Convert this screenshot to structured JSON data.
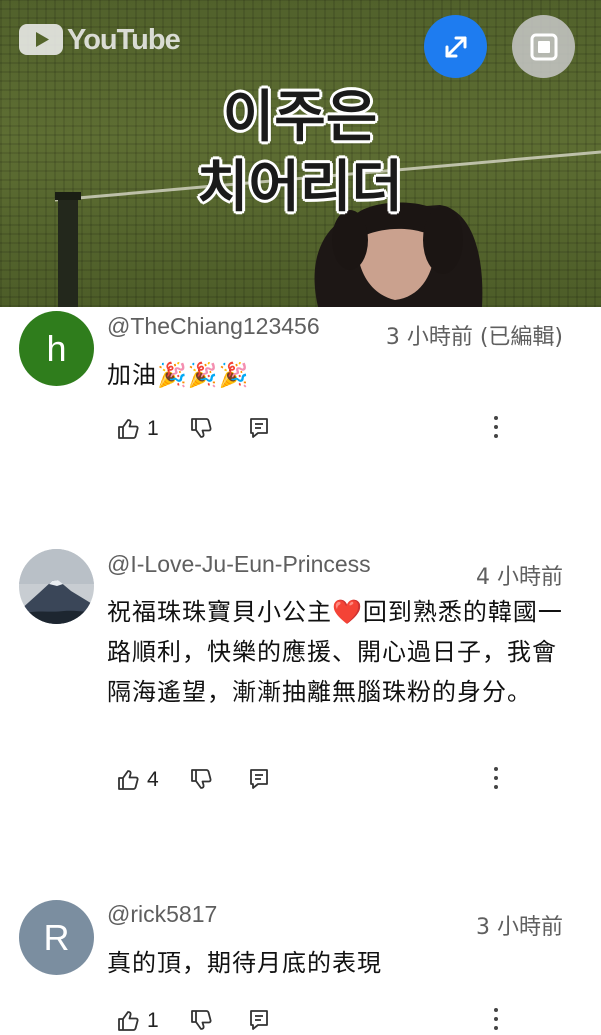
{
  "video": {
    "brand": "YouTube",
    "caption_line1": "이주은",
    "caption_line2": "치어리더",
    "expand_button_icon": "expand-arrows-icon",
    "pip_button_icon": "picture-in-picture-icon"
  },
  "comments": [
    {
      "avatar_letter": "h",
      "avatar_color": "#2f7d1c",
      "author": "@TheChiang123456",
      "time": "3 小時前 (已編輯)",
      "text": "加油🎉🎉🎉",
      "likes": "1"
    },
    {
      "avatar_letter": "",
      "avatar_image": "mountain-landscape",
      "author": "@I-Love-Ju-Eun-Princess",
      "time": "4 小時前",
      "text": "祝福珠珠寶貝小公主❤️回到熟悉的韓國一路順利，快樂的應援、開心過日子，我會隔海遙望，漸漸抽離無腦珠粉的身分。",
      "likes": "4"
    },
    {
      "avatar_letter": "R",
      "avatar_color": "#7b8ea0",
      "author": "@rick5817",
      "time": "3 小時前",
      "text": "真的頂，期待月底的表現",
      "likes": "1"
    }
  ]
}
